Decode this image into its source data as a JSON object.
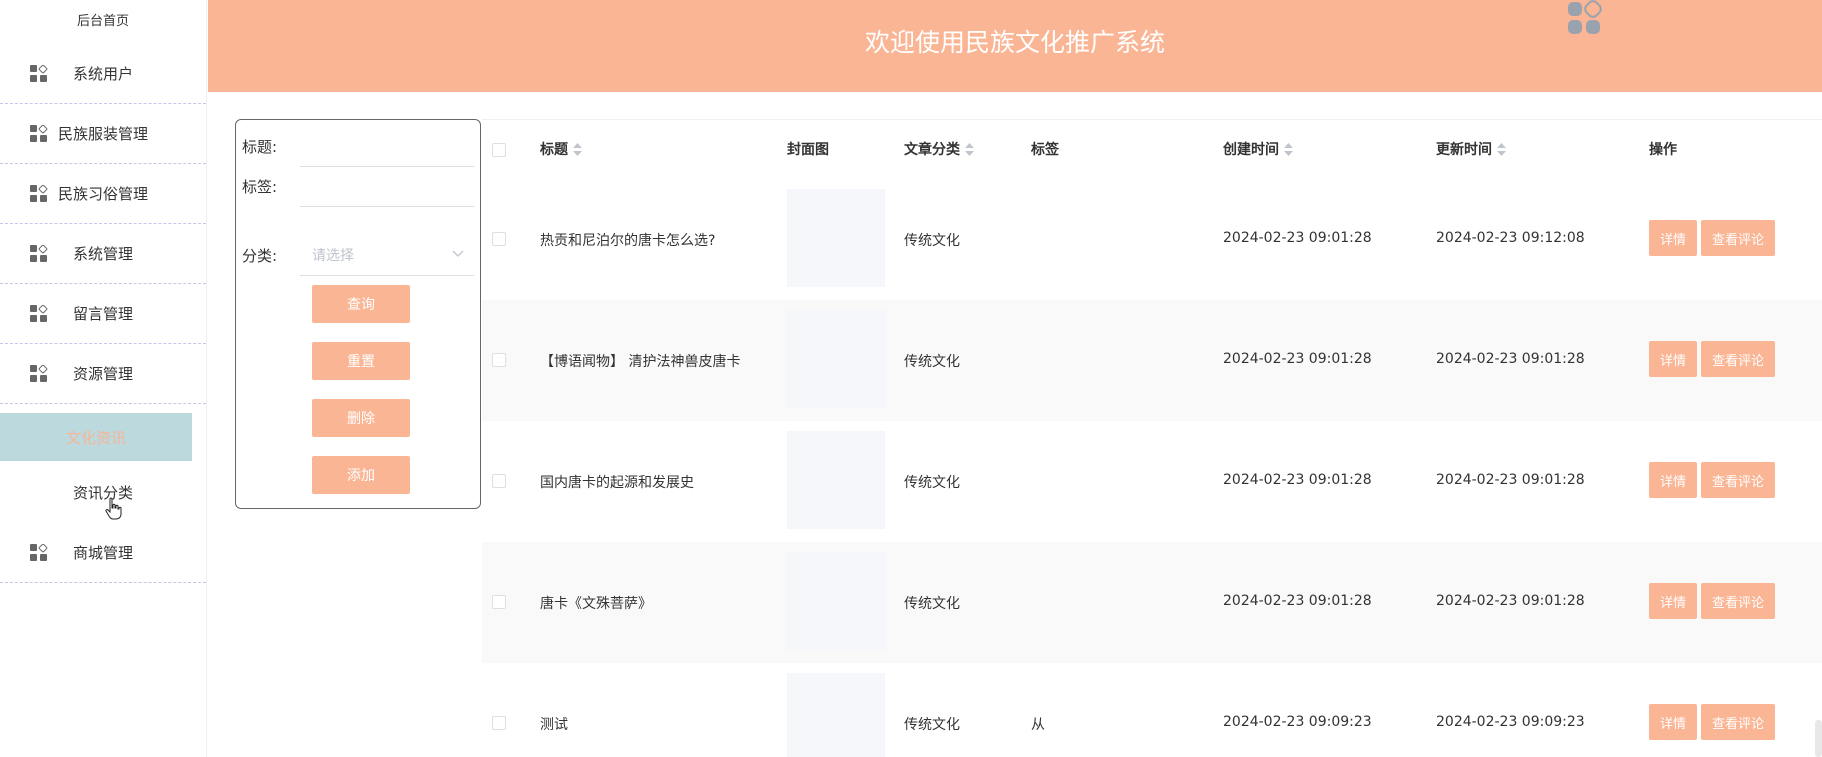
{
  "header": {
    "title": "欢迎使用民族文化推广系统"
  },
  "sidebar": {
    "home": "后台首页",
    "items": [
      {
        "label": "系统用户",
        "icon": "grid-icon"
      },
      {
        "label": "民族服装管理",
        "icon": "grid-icon"
      },
      {
        "label": "民族习俗管理",
        "icon": "grid-icon"
      },
      {
        "label": "系统管理",
        "icon": "grid-icon"
      },
      {
        "label": "留言管理",
        "icon": "grid-icon"
      },
      {
        "label": "资源管理",
        "icon": "grid-icon"
      }
    ],
    "active": "文化资讯",
    "sub": "资讯分类",
    "last": {
      "label": "商城管理",
      "icon": "grid-icon"
    }
  },
  "filter": {
    "title_label": "标题:",
    "tag_label": "标签:",
    "category_label": "分类:",
    "category_placeholder": "请选择",
    "query": "查询",
    "reset": "重置",
    "delete": "删除",
    "add": "添加"
  },
  "table": {
    "headers": {
      "title": "标题",
      "cover": "封面图",
      "category": "文章分类",
      "tag": "标签",
      "created": "创建时间",
      "updated": "更新时间",
      "actions": "操作"
    },
    "rows": [
      {
        "title": "热贡和尼泊尔的唐卡怎么选?",
        "category": "传统文化",
        "tag": "",
        "created": "2024-02-23 09:01:28",
        "updated": "2024-02-23 09:12:08"
      },
      {
        "title": "【博语闻物】 清护法神兽皮唐卡",
        "category": "传统文化",
        "tag": "",
        "created": "2024-02-23 09:01:28",
        "updated": "2024-02-23 09:01:28"
      },
      {
        "title": "国内唐卡的起源和发展史",
        "category": "传统文化",
        "tag": "",
        "created": "2024-02-23 09:01:28",
        "updated": "2024-02-23 09:01:28"
      },
      {
        "title": "唐卡《文殊菩萨》",
        "category": "传统文化",
        "tag": "",
        "created": "2024-02-23 09:01:28",
        "updated": "2024-02-23 09:01:28"
      },
      {
        "title": "测试",
        "category": "传统文化",
        "tag": "从",
        "created": "2024-02-23 09:09:23",
        "updated": "2024-02-23 09:09:23"
      }
    ],
    "detail_label": "详情",
    "comments_label": "查看评论"
  },
  "colors": {
    "accent": "#fab595",
    "active_bg": "#bcd9dd",
    "sidebar_divider": "#c9c4ea"
  }
}
